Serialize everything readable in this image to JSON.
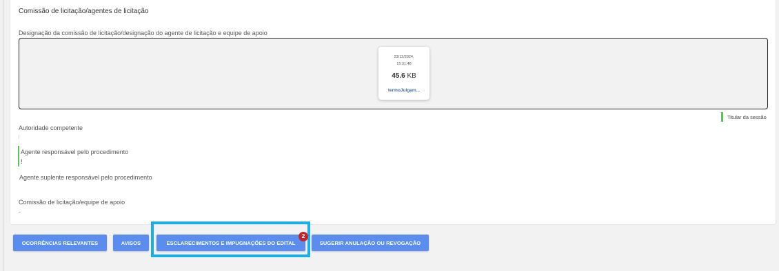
{
  "section": {
    "title": "Comissão de licitação/agentes de licitação",
    "designation_label": "Designação da comissão de licitação/designação do agente de licitação e equipe de apoio"
  },
  "file": {
    "date": "23/12/2024,",
    "time": "15:31:48",
    "size_value": "45.6",
    "size_unit": "KB",
    "name": "termoJulgam..."
  },
  "legend": {
    "label": "Titular da sessão",
    "color": "#5cc15c"
  },
  "fields": {
    "authority_label": "Autoridade competente",
    "agent_label": "Agente responsável pelo procedimento",
    "agent_value": "!",
    "substitute_label": "Agente suplente responsável pelo procedimento",
    "commission_label": "Comissão de licitação/equipe de apoio",
    "commission_value": "-"
  },
  "buttons": {
    "ocorrencias": "OCORRÊNCIAS RELEVANTES",
    "avisos": "AVISOS",
    "esclarecimentos": "ESCLARECIMENTOS E IMPUGNAÇÕES DO EDITAL",
    "esclarecimentos_badge": "2",
    "sugerir": "SUGERIR ANULAÇÃO OU REVOGAÇÃO"
  },
  "colors": {
    "button": "#5b8def",
    "badge": "#c0282f",
    "highlight": "#1aaee8"
  }
}
